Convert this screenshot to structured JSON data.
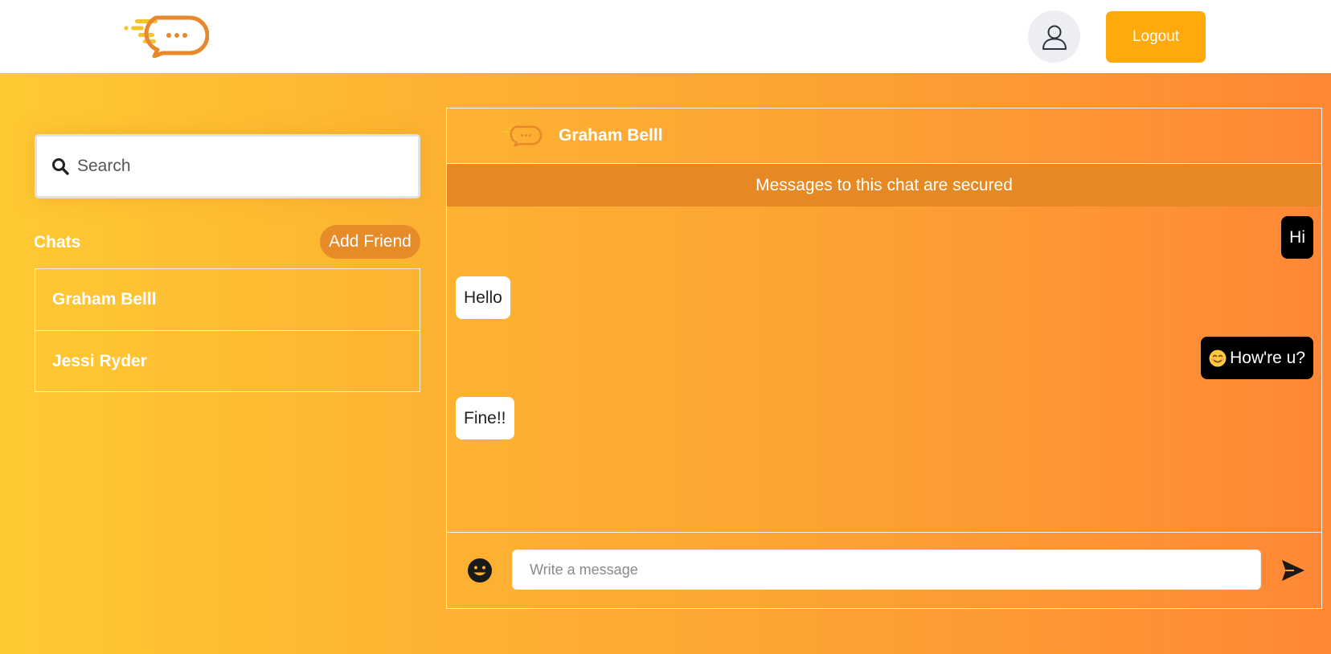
{
  "header": {
    "logo_icon": "chat-bubble-logo-icon",
    "profile_icon": "user-outline-icon",
    "logout_label": "Logout"
  },
  "sidebar": {
    "search_placeholder": "Search",
    "chats_label": "Chats",
    "add_friend_label": "Add Friend",
    "chats": [
      {
        "name": "Graham Belll"
      },
      {
        "name": "Jessi Ryder"
      }
    ]
  },
  "chat": {
    "contact_name": "Graham Belll",
    "secured_notice": "Messages to this chat are secured",
    "messages": [
      {
        "direction": "out",
        "text": "Hi"
      },
      {
        "direction": "in",
        "text": "Hello"
      },
      {
        "direction": "out",
        "text": "How're u?",
        "emoji": "smiling-face"
      },
      {
        "direction": "in",
        "text": "Fine!!"
      }
    ],
    "input_placeholder": "Write a message"
  },
  "colors": {
    "brand_orange": "#ffa90a",
    "gradient_start": "#fec933",
    "gradient_end": "#fe8736",
    "banner": "#e68924",
    "add_friend_bg": "#e68b28"
  }
}
